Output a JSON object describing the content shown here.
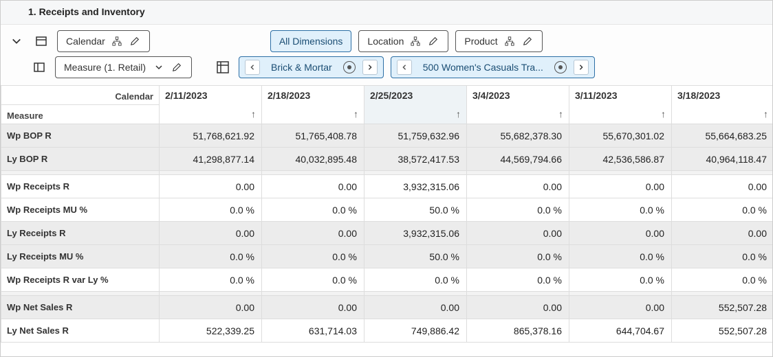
{
  "section_title": "1. Receipts and Inventory",
  "toolbar": {
    "calendar_label": "Calendar",
    "measure_label": "Measure (1. Retail)",
    "all_dimensions_label": "All Dimensions",
    "location_label": "Location",
    "product_label": "Product"
  },
  "nav": {
    "location_value": "Brick & Mortar",
    "product_value": "500 Women's Casuals Tra..."
  },
  "table": {
    "corner_top": "Calendar",
    "corner_bottom": "Measure",
    "columns": [
      "2/11/2023",
      "2/18/2023",
      "2/25/2023",
      "3/4/2023",
      "3/11/2023",
      "3/18/2023"
    ],
    "selected_col_index": 2,
    "groups": [
      {
        "rows": [
          {
            "label": "Wp BOP R",
            "shaded": true,
            "cells": [
              "51,768,621.92",
              "51,765,408.78",
              "51,759,632.96",
              "55,682,378.30",
              "55,670,301.02",
              "55,664,683.25"
            ]
          },
          {
            "label": "Ly BOP R",
            "shaded": true,
            "cells": [
              "41,298,877.14",
              "40,032,895.48",
              "38,572,417.53",
              "44,569,794.66",
              "42,536,586.87",
              "40,964,118.47"
            ]
          }
        ]
      },
      {
        "rows": [
          {
            "label": "Wp Receipts R",
            "shaded": false,
            "cells": [
              "0.00",
              "0.00",
              "3,932,315.06",
              "0.00",
              "0.00",
              "0.00"
            ]
          },
          {
            "label": "Wp Receipts MU %",
            "shaded": false,
            "cells": [
              "0.0 %",
              "0.0 %",
              "50.0 %",
              "0.0 %",
              "0.0 %",
              "0.0 %"
            ]
          },
          {
            "label": "Ly Receipts R",
            "shaded": true,
            "cells": [
              "0.00",
              "0.00",
              "3,932,315.06",
              "0.00",
              "0.00",
              "0.00"
            ]
          },
          {
            "label": "Ly Receipts MU %",
            "shaded": true,
            "cells": [
              "0.0 %",
              "0.0 %",
              "50.0 %",
              "0.0 %",
              "0.0 %",
              "0.0 %"
            ]
          },
          {
            "label": "Wp Receipts R var Ly %",
            "shaded": false,
            "cells": [
              "0.0 %",
              "0.0 %",
              "0.0 %",
              "0.0 %",
              "0.0 %",
              "0.0 %"
            ]
          }
        ]
      },
      {
        "rows": [
          {
            "label": "Wp Net Sales R",
            "shaded": true,
            "cells": [
              "0.00",
              "0.00",
              "0.00",
              "0.00",
              "0.00",
              "552,507.28"
            ]
          },
          {
            "label": "Ly Net Sales R",
            "shaded": false,
            "cells": [
              "522,339.25",
              "631,714.03",
              "749,886.42",
              "865,378.16",
              "644,704.67",
              "552,507.28"
            ]
          }
        ]
      }
    ]
  }
}
